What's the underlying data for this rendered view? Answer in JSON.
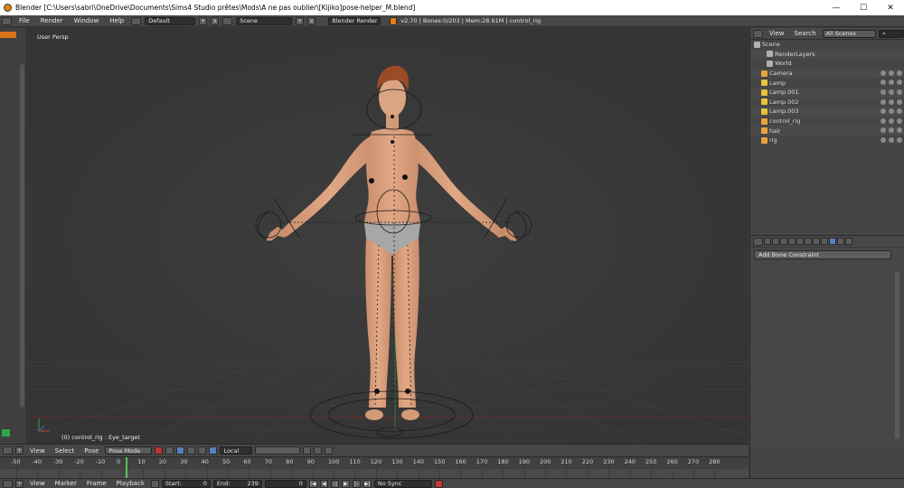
{
  "window": {
    "title": "Blender [C:\\Users\\sabri\\OneDrive\\Documents\\Sims4 Studio prêtes\\Mods\\A ne pas oublier\\[Kijiko]pose-helper_M.blend]",
    "minimize": "—",
    "maximize": "☐",
    "close": "✕"
  },
  "info_header": {
    "menus": [
      "File",
      "Render",
      "Window",
      "Help"
    ],
    "layout": "Default",
    "scene": "Scene",
    "engine": "Blender Render",
    "stats": "v2.70 | Bones:0/203 | Mem:28.61M | control_rig"
  },
  "viewport": {
    "view_label": "User Persp",
    "status_label": "(0) control_rig : Eye_target"
  },
  "view3d_header": {
    "menus": [
      "View",
      "Select",
      "Pose"
    ],
    "mode": "Pose Mode",
    "orientation": "Local"
  },
  "timeline": {
    "ticks": [
      "-50",
      "-40",
      "-30",
      "-20",
      "-10",
      "0",
      "10",
      "20",
      "30",
      "40",
      "50",
      "60",
      "70",
      "80",
      "90",
      "100",
      "110",
      "120",
      "130",
      "140",
      "150",
      "160",
      "170",
      "180",
      "190",
      "200",
      "210",
      "220",
      "230",
      "240",
      "250",
      "260",
      "270",
      "280"
    ],
    "current_frame": "0"
  },
  "timeline_header": {
    "menus": [
      "View",
      "Marker",
      "Frame",
      "Playback"
    ],
    "start_label": "Start:",
    "start_value": "0",
    "end_label": "End:",
    "end_value": "239",
    "frame_value": "0",
    "sync": "No Sync"
  },
  "outliner": {
    "menus": [
      "View",
      "Search"
    ],
    "filter": "All Scenes",
    "items": [
      {
        "label": "Scene",
        "icon": "scene-icon",
        "color": "#b0b0b0"
      },
      {
        "label": "RenderLayers",
        "icon": "renderlayers-icon",
        "color": "#b0b0b0"
      },
      {
        "label": "World",
        "icon": "world-icon",
        "color": "#b0b0b0"
      },
      {
        "label": "Camera",
        "icon": "camera-icon",
        "color": "#e8a33c"
      },
      {
        "label": "Lamp",
        "icon": "lamp-icon",
        "color": "#e8c23c"
      },
      {
        "label": "Lamp.001",
        "icon": "lamp-icon",
        "color": "#e8c23c"
      },
      {
        "label": "Lamp.002",
        "icon": "lamp-icon",
        "color": "#e8c23c"
      },
      {
        "label": "Lamp.003",
        "icon": "lamp-icon",
        "color": "#e8c23c"
      },
      {
        "label": "control_rig",
        "icon": "armature-icon",
        "color": "#e8a33c"
      },
      {
        "label": "hair",
        "icon": "mesh-icon",
        "color": "#e8a33c"
      },
      {
        "label": "rig",
        "icon": "mesh-icon",
        "color": "#e8a33c"
      }
    ]
  },
  "properties": {
    "add_constraint": "Add Bone Constraint"
  },
  "colors": {
    "accent": "#5680c2",
    "viewport_bg": "#393939",
    "panel_bg": "#474747",
    "skin": "#d9a07c"
  }
}
